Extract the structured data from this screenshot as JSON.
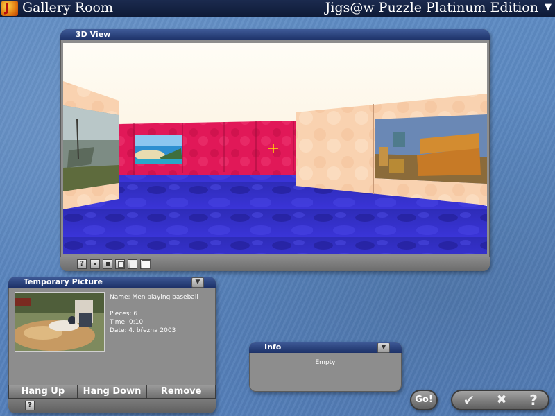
{
  "window": {
    "room_title": "Gallery Room",
    "app_edition": "Jigs@w Puzzle Platinum Edition",
    "logo_glyph": "J"
  },
  "view3d": {
    "title": "3D View",
    "toolbar": {
      "help": "?"
    }
  },
  "temporary_picture": {
    "title": "Temporary Picture",
    "name_line": "Name: Men playing baseball",
    "pieces_line": "Pieces: 6",
    "time_line": "Time: 0:10",
    "date_line": "Date: 4. března 2003",
    "buttons": {
      "hang_up": "Hang Up",
      "hang_down": "Hang Down",
      "remove": "Remove"
    },
    "help": "?"
  },
  "info_panel": {
    "title": "Info",
    "body": "Empty"
  },
  "actions": {
    "go": "Go!",
    "ok": "✔",
    "cancel": "✖",
    "help": "?"
  },
  "colors": {
    "title_bar": "#0e1a36",
    "panel_header": "#1d3167",
    "panel_body": "#8d8d8d",
    "background": "#5a86bf",
    "crosshair": "#ffe000"
  },
  "icons": [
    "app-logo-icon",
    "menu-arrow-icon",
    "dropdown-arrow-icon",
    "crosshair-icon",
    "check-icon",
    "close-icon",
    "help-icon"
  ]
}
